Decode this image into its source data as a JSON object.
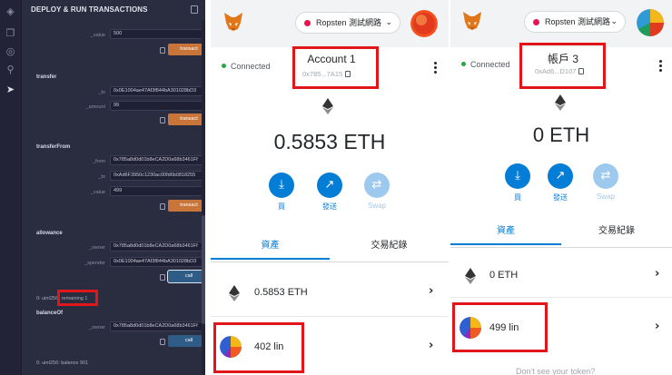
{
  "remix": {
    "header_title": "DEPLOY & RUN TRANSACTIONS",
    "iconbar_icons": [
      "home-icon",
      "file-explorer-icon",
      "compiler-icon",
      "search-icon",
      "deploy-icon"
    ],
    "top_param": {
      "label": "_value",
      "value": "500",
      "button": "transact"
    },
    "transfer": {
      "title": "transfer",
      "params": [
        {
          "label": "_to",
          "value": "0x0E1004ae47Af3f844bA301028bD3"
        },
        {
          "label": "_amount",
          "value": "99"
        }
      ],
      "button": "transact"
    },
    "transferFrom": {
      "title": "transferFrom",
      "params": [
        {
          "label": "_from",
          "value": "0x785a8d0d01b8eCA2D0a68b3461Ff"
        },
        {
          "label": "_to",
          "value": "0xAd6F3950c1230ac00fd6b0818255"
        },
        {
          "label": "_value",
          "value": "499"
        }
      ],
      "button": "transact"
    },
    "allowance": {
      "title": "allowance",
      "params": [
        {
          "label": "_owner",
          "value": "0x785a8d0d01b8eCA2D0a68b3461Ff"
        },
        {
          "label": "_spender",
          "value": "0x0E1004ae47Af3f844bA301028bD3"
        }
      ],
      "button": "call",
      "result_prefix": "0: uint256",
      "result_value": "remaining 1"
    },
    "balanceOf": {
      "title": "balanceOf",
      "params": [
        {
          "label": "_owner",
          "value": "0x785a8d0d01b8eCA2D0a68b3461Ff"
        }
      ],
      "button": "call",
      "result": "0: uint256: balance 901"
    }
  },
  "phone1": {
    "network": "Ropsten 測試網路",
    "connected": "Connected",
    "account_name": "Account 1",
    "account_address": "0x785...7A15",
    "balance": "0.5853 ETH",
    "actions": [
      {
        "label": "買",
        "icon": "download-icon",
        "disabled": false
      },
      {
        "label": "發送",
        "icon": "send-arrow-icon",
        "disabled": false
      },
      {
        "label": "Swap",
        "icon": "swap-icon",
        "disabled": true
      }
    ],
    "tabs": [
      "資產",
      "交易紀錄"
    ],
    "assets": [
      {
        "name": "0.5853 ETH",
        "icon": "eth-icon"
      },
      {
        "name": "402 lin",
        "icon": "token-icon"
      }
    ]
  },
  "phone2": {
    "network": "Ropsten 測試網路",
    "connected": "Connected",
    "account_name": "帳戶 3",
    "account_address": "0xAd6...D107",
    "balance": "0 ETH",
    "actions": [
      {
        "label": "買",
        "icon": "download-icon",
        "disabled": false
      },
      {
        "label": "發送",
        "icon": "send-arrow-icon",
        "disabled": false
      },
      {
        "label": "Swap",
        "icon": "swap-icon",
        "disabled": true
      }
    ],
    "tabs": [
      "資產",
      "交易紀錄"
    ],
    "assets": [
      {
        "name": "0 ETH",
        "icon": "eth-icon"
      },
      {
        "name": "499 lin",
        "icon": "token-icon"
      }
    ],
    "footer_hint": "Don't see your token?"
  },
  "colors": {
    "remix_bg": "#2a2c3f",
    "transact": "#c97539",
    "call": "#2f5b87",
    "mm_blue": "#037dd6",
    "highlight_red": "#e0161b"
  }
}
